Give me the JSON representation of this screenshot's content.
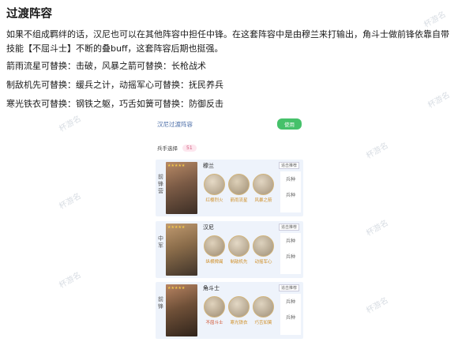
{
  "article": {
    "heading": "过渡阵容",
    "intro": "如果不组成羁绊的话，汉尼也可以在其他阵容中担任中锋。在这套阵容中是由穆兰来打输出，角斗士做前锋依靠自带技能【不屈斗士】不断的叠buff，这套阵容后期也挺强。",
    "lines": [
      "箭雨流星可替换：击破，风暴之箭可替换：长枪战术",
      "制敌机先可替换：缓兵之计，动摇军心可替换：抚民养兵",
      "寒光铁衣可替换：钢铁之躯，巧舌如簧可替换：防御反击"
    ]
  },
  "watermark": "杯游名",
  "card": {
    "title": "汉尼过渡阵容",
    "apply_label": "使用",
    "sub_label": "兵手选择",
    "sub_count": "51",
    "rows": [
      {
        "position": "前锋营",
        "hero_name": "穆兰",
        "tag": "追击推荐",
        "skills": [
          "红樱烈火",
          "箭雨流星",
          "风暴之箭"
        ],
        "side_top": "兵种",
        "side_bottom": "兵种",
        "colors": {
          "portrait": "#7a5a45",
          "icon": "#c9b9a2"
        }
      },
      {
        "position": "中军",
        "hero_name": "汉尼",
        "tag": "追击推荐",
        "skills": [
          "纵横捭阖",
          "制敌机先",
          "动摇军心"
        ],
        "side_top": "兵种",
        "side_bottom": "兵种",
        "colors": {
          "portrait": "#8a6c4a",
          "icon": "#c7b59a"
        }
      },
      {
        "position": "前锋",
        "hero_name": "角斗士",
        "tag": "追击推荐",
        "skills": [
          "不屈斗士",
          "寒光铁衣",
          "巧舌如簧"
        ],
        "side_top": "兵种",
        "side_bottom": "兵种",
        "colors": {
          "portrait": "#6f5038",
          "icon": "#bfb3a0"
        }
      }
    ]
  }
}
